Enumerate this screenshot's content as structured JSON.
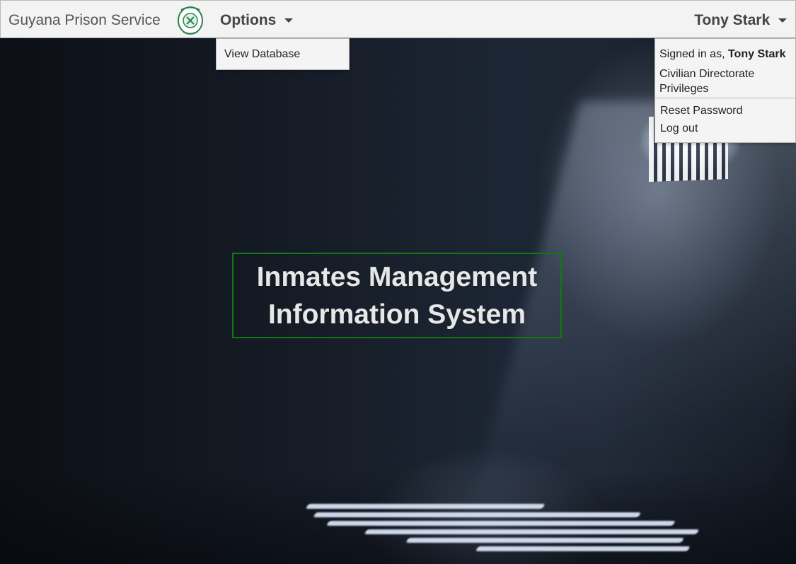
{
  "navbar": {
    "brand": "Guyana Prison Service",
    "logo_icon": "prison-service-crest-icon",
    "options_label": "Options",
    "user_label": "Tony Stark"
  },
  "options_menu": {
    "items": [
      "View Database"
    ]
  },
  "user_menu": {
    "signed_in_prefix": "Signed in as,",
    "signed_in_name": "Tony Stark",
    "privileges": "Civilian Directorate Privileges",
    "reset_password": "Reset Password",
    "logout": "Log out"
  },
  "hero": {
    "line1": "Inmates Management",
    "line2": "Information System"
  },
  "colors": {
    "navbar_bg": "#f3f3f3",
    "title_border": "#0f7a0f",
    "title_text": "#e7e7e7"
  }
}
